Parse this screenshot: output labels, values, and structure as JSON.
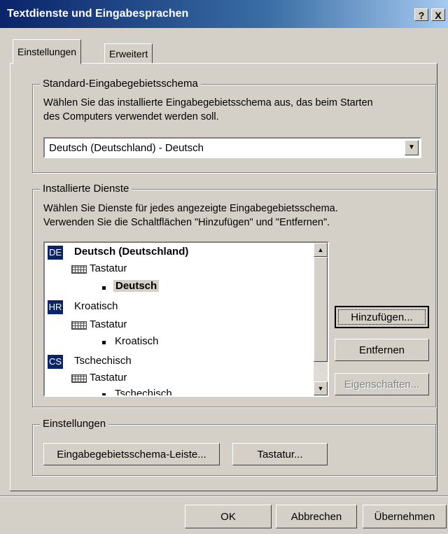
{
  "window": {
    "title": "Textdienste und Eingabesprachen",
    "help_button": "?",
    "close_button": "X"
  },
  "tabs": [
    {
      "label": "Einstellungen",
      "active": true
    },
    {
      "label": "Erweitert",
      "active": false
    }
  ],
  "default_layout": {
    "legend": "Standard-Eingabegebietsschema",
    "description_line1": "Wählen Sie das installierte Eingabegebietsschema aus, das beim Starten",
    "description_line2": "des Computers verwendet werden soll.",
    "selected_value": "Deutsch (Deutschland) - Deutsch"
  },
  "installed_services": {
    "legend": "Installierte Dienste",
    "description_line1": "Wählen Sie Dienste für jedes angezeigte Eingabegebietsschema.",
    "description_line2": "Verwenden Sie die Schaltflächen \"Hinzufügen\" und \"Entfernen\".",
    "tree": [
      {
        "code": "DE",
        "language": "Deutsch (Deutschland)",
        "category": "Tastatur",
        "layout": "Deutsch"
      },
      {
        "code": "HR",
        "language": "Kroatisch",
        "category": "Tastatur",
        "layout": "Kroatisch"
      },
      {
        "code": "CS",
        "language": "Tschechisch",
        "category": "Tastatur",
        "layout": "Tschechisch"
      }
    ],
    "add_button": "Hinzufügen...",
    "remove_button": "Entfernen",
    "properties_button": "Eigenschaften..."
  },
  "settings_group": {
    "legend": "Einstellungen",
    "language_bar_button": "Eingabegebietsschema-Leiste...",
    "keyboard_button": "Tastatur..."
  },
  "footer": {
    "ok_button": "OK",
    "cancel_button": "Abbrechen",
    "apply_button": "Übernehmen"
  }
}
